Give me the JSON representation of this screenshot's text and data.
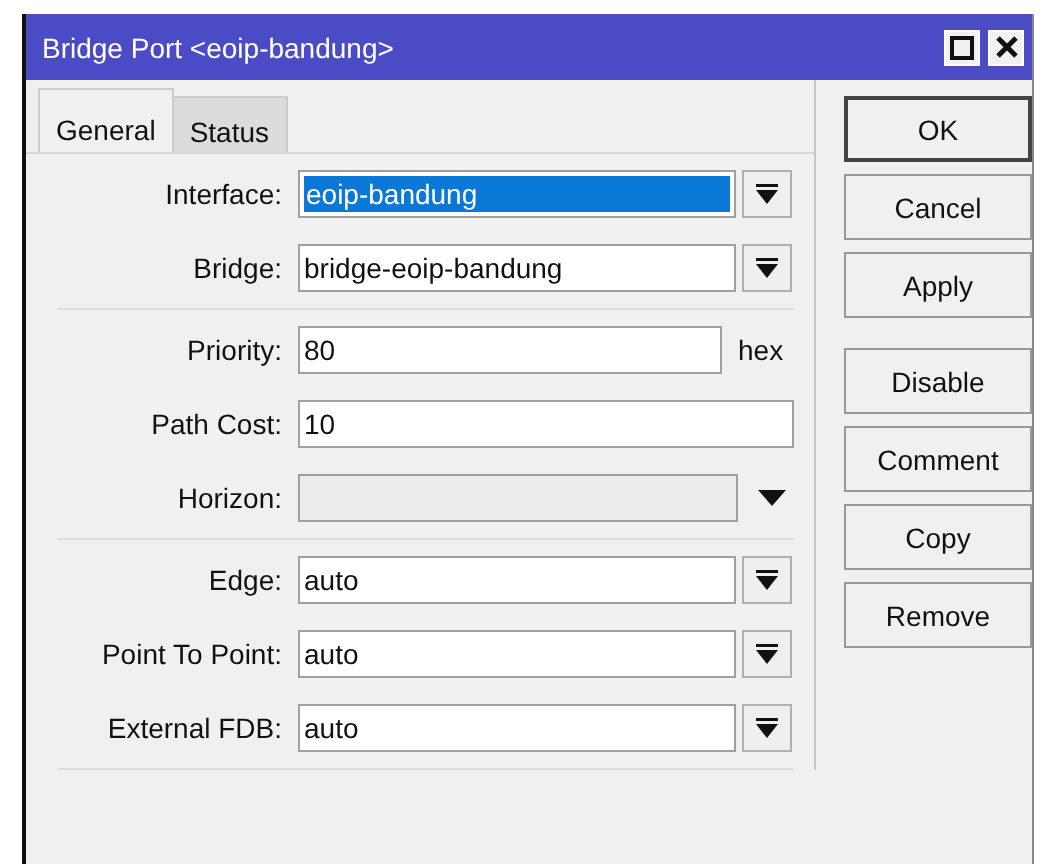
{
  "window": {
    "title": "Bridge Port <eoip-bandung>"
  },
  "tabs": [
    {
      "label": "General",
      "selected": true
    },
    {
      "label": "Status",
      "selected": false
    }
  ],
  "groups": [
    [
      {
        "kind": "combo",
        "label": "Interface:",
        "value": "eoip-bandung",
        "highlighted": true
      },
      {
        "kind": "combo",
        "label": "Bridge:",
        "value": "bridge-eoip-bandung",
        "highlighted": false
      }
    ],
    [
      {
        "kind": "text",
        "label": "Priority:",
        "value": "80",
        "suffix": "hex"
      },
      {
        "kind": "text",
        "label": "Path Cost:",
        "value": "10"
      },
      {
        "kind": "select",
        "label": "Horizon:",
        "disabled": true
      }
    ],
    [
      {
        "kind": "combo",
        "label": "Edge:",
        "value": "auto",
        "highlighted": false
      },
      {
        "kind": "combo",
        "label": "Point To Point:",
        "value": "auto",
        "highlighted": false
      },
      {
        "kind": "combo",
        "label": "External FDB:",
        "value": "auto",
        "highlighted": false
      }
    ]
  ],
  "buttons": [
    [
      "OK",
      "Cancel",
      "Apply"
    ],
    [
      "Disable",
      "Comment",
      "Copy",
      "Remove"
    ]
  ]
}
